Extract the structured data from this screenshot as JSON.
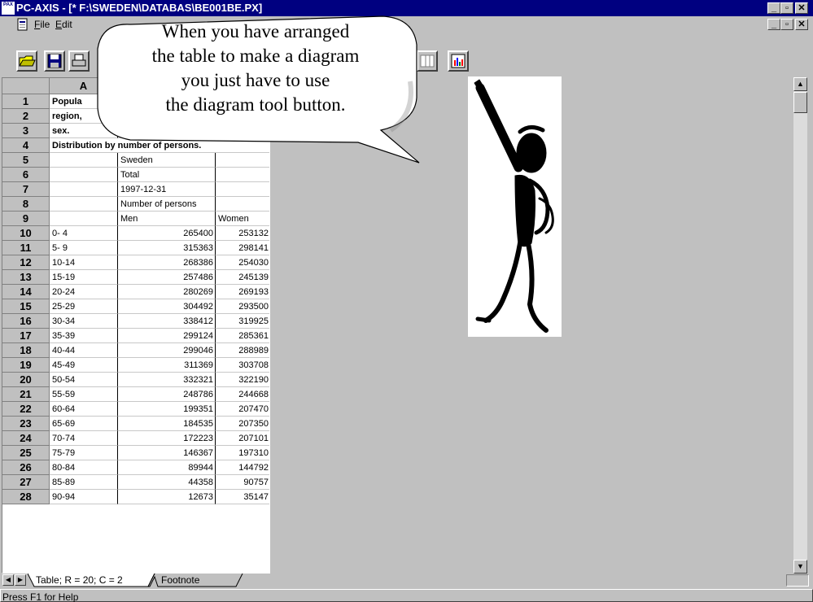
{
  "window": {
    "title": "PC-AXIS - [* F:\\SWEDEN\\DATABAS\\BE001BE.PX]",
    "app_icon_text": "PAX",
    "minimize": "_",
    "restore": "▫",
    "close": "✕"
  },
  "menu": {
    "items": [
      "File",
      "Edit"
    ]
  },
  "grid": {
    "col_headers": [
      "A"
    ],
    "rows": [
      {
        "num": "1",
        "a": "Popula"
      },
      {
        "num": "2",
        "a": "region,"
      },
      {
        "num": "3",
        "a": "sex."
      },
      {
        "num": "4",
        "a": "Distribution by number of persons."
      },
      {
        "num": "5",
        "a": "",
        "b": "Sweden",
        "c": ""
      },
      {
        "num": "6",
        "a": "",
        "b": "Total",
        "c": ""
      },
      {
        "num": "7",
        "a": "",
        "b": "1997-12-31",
        "c": ""
      },
      {
        "num": "8",
        "a": "",
        "b": "Number of persons",
        "c": ""
      },
      {
        "num": "9",
        "a": "",
        "b": "Men",
        "c": "Women"
      },
      {
        "num": "10",
        "a": "0- 4",
        "b": "265400",
        "c": "253132"
      },
      {
        "num": "11",
        "a": "5- 9",
        "b": "315363",
        "c": "298141"
      },
      {
        "num": "12",
        "a": "10-14",
        "b": "268386",
        "c": "254030"
      },
      {
        "num": "13",
        "a": "15-19",
        "b": "257486",
        "c": "245139"
      },
      {
        "num": "14",
        "a": "20-24",
        "b": "280269",
        "c": "269193"
      },
      {
        "num": "15",
        "a": "25-29",
        "b": "304492",
        "c": "293500"
      },
      {
        "num": "16",
        "a": "30-34",
        "b": "338412",
        "c": "319925"
      },
      {
        "num": "17",
        "a": "35-39",
        "b": "299124",
        "c": "285361"
      },
      {
        "num": "18",
        "a": "40-44",
        "b": "299046",
        "c": "288989"
      },
      {
        "num": "19",
        "a": "45-49",
        "b": "311369",
        "c": "303708"
      },
      {
        "num": "20",
        "a": "50-54",
        "b": "332321",
        "c": "322190"
      },
      {
        "num": "21",
        "a": "55-59",
        "b": "248786",
        "c": "244668"
      },
      {
        "num": "22",
        "a": "60-64",
        "b": "199351",
        "c": "207470"
      },
      {
        "num": "23",
        "a": "65-69",
        "b": "184535",
        "c": "207350"
      },
      {
        "num": "24",
        "a": "70-74",
        "b": "172223",
        "c": "207101"
      },
      {
        "num": "25",
        "a": "75-79",
        "b": "146367",
        "c": "197310"
      },
      {
        "num": "26",
        "a": "80-84",
        "b": "89944",
        "c": "144792"
      },
      {
        "num": "27",
        "a": "85-89",
        "b": "44358",
        "c": "90757"
      },
      {
        "num": "28",
        "a": "90-94",
        "b": "12673",
        "c": "35147"
      }
    ]
  },
  "tabs": {
    "table": "Table; R = 20; C = 2",
    "footnote": "Footnote"
  },
  "status": {
    "text": "Press F1 for Help"
  },
  "callout": {
    "lines": [
      "When you have arranged",
      "the table to make a diagram",
      "you just have to use",
      "the diagram tool button."
    ]
  },
  "colors": {
    "titlebar": "#000080",
    "face": "#c0c0c0"
  }
}
